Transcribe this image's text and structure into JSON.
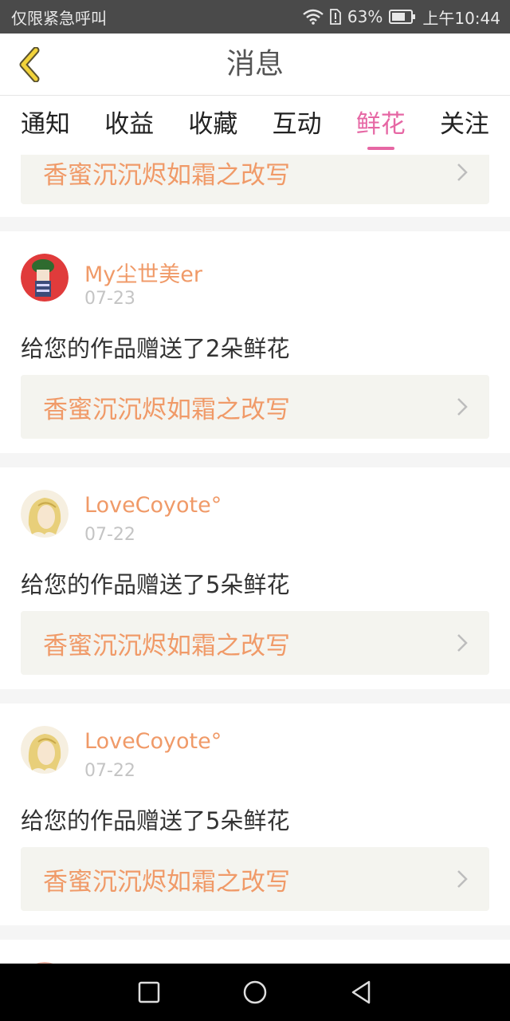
{
  "status_bar": {
    "carrier_text": "仅限紧急呼叫",
    "battery_percent": "63%",
    "time": "上午10:44",
    "icons": [
      "wifi-icon",
      "sim-alert-icon",
      "battery-icon"
    ]
  },
  "header": {
    "title": "消息",
    "back_icon": "chevron-left-icon"
  },
  "tabs": [
    {
      "label": "通知",
      "active": false
    },
    {
      "label": "收益",
      "active": false
    },
    {
      "label": "收藏",
      "active": false
    },
    {
      "label": "互动",
      "active": false
    },
    {
      "label": "鲜花",
      "active": true
    },
    {
      "label": "关注",
      "active": false
    }
  ],
  "feed": {
    "partial_top_card": {
      "work_title": "香蜜沉沉烬如霜之改写"
    },
    "items": [
      {
        "username": "My尘世美er",
        "date": "07-23",
        "message": "给您的作品赠送了2朵鲜花",
        "work_title": "香蜜沉沉烬如霜之改写"
      },
      {
        "username": "LoveCoyote°",
        "date": "07-22",
        "message": "给您的作品赠送了5朵鲜花",
        "work_title": "香蜜沉沉烬如霜之改写"
      },
      {
        "username": "LoveCoyote°",
        "date": "07-22",
        "message": "给您的作品赠送了5朵鲜花",
        "work_title": "香蜜沉沉烬如霜之改写"
      }
    ]
  },
  "colors": {
    "accent_pink": "#e667a4",
    "work_title_orange": "#f09a68",
    "work_box_bg": "#f4f4ef",
    "status_bar_bg": "#4a4a4a"
  },
  "nav_bar": {
    "icons": [
      "recent-apps-icon",
      "home-icon",
      "back-triangle-icon"
    ]
  }
}
